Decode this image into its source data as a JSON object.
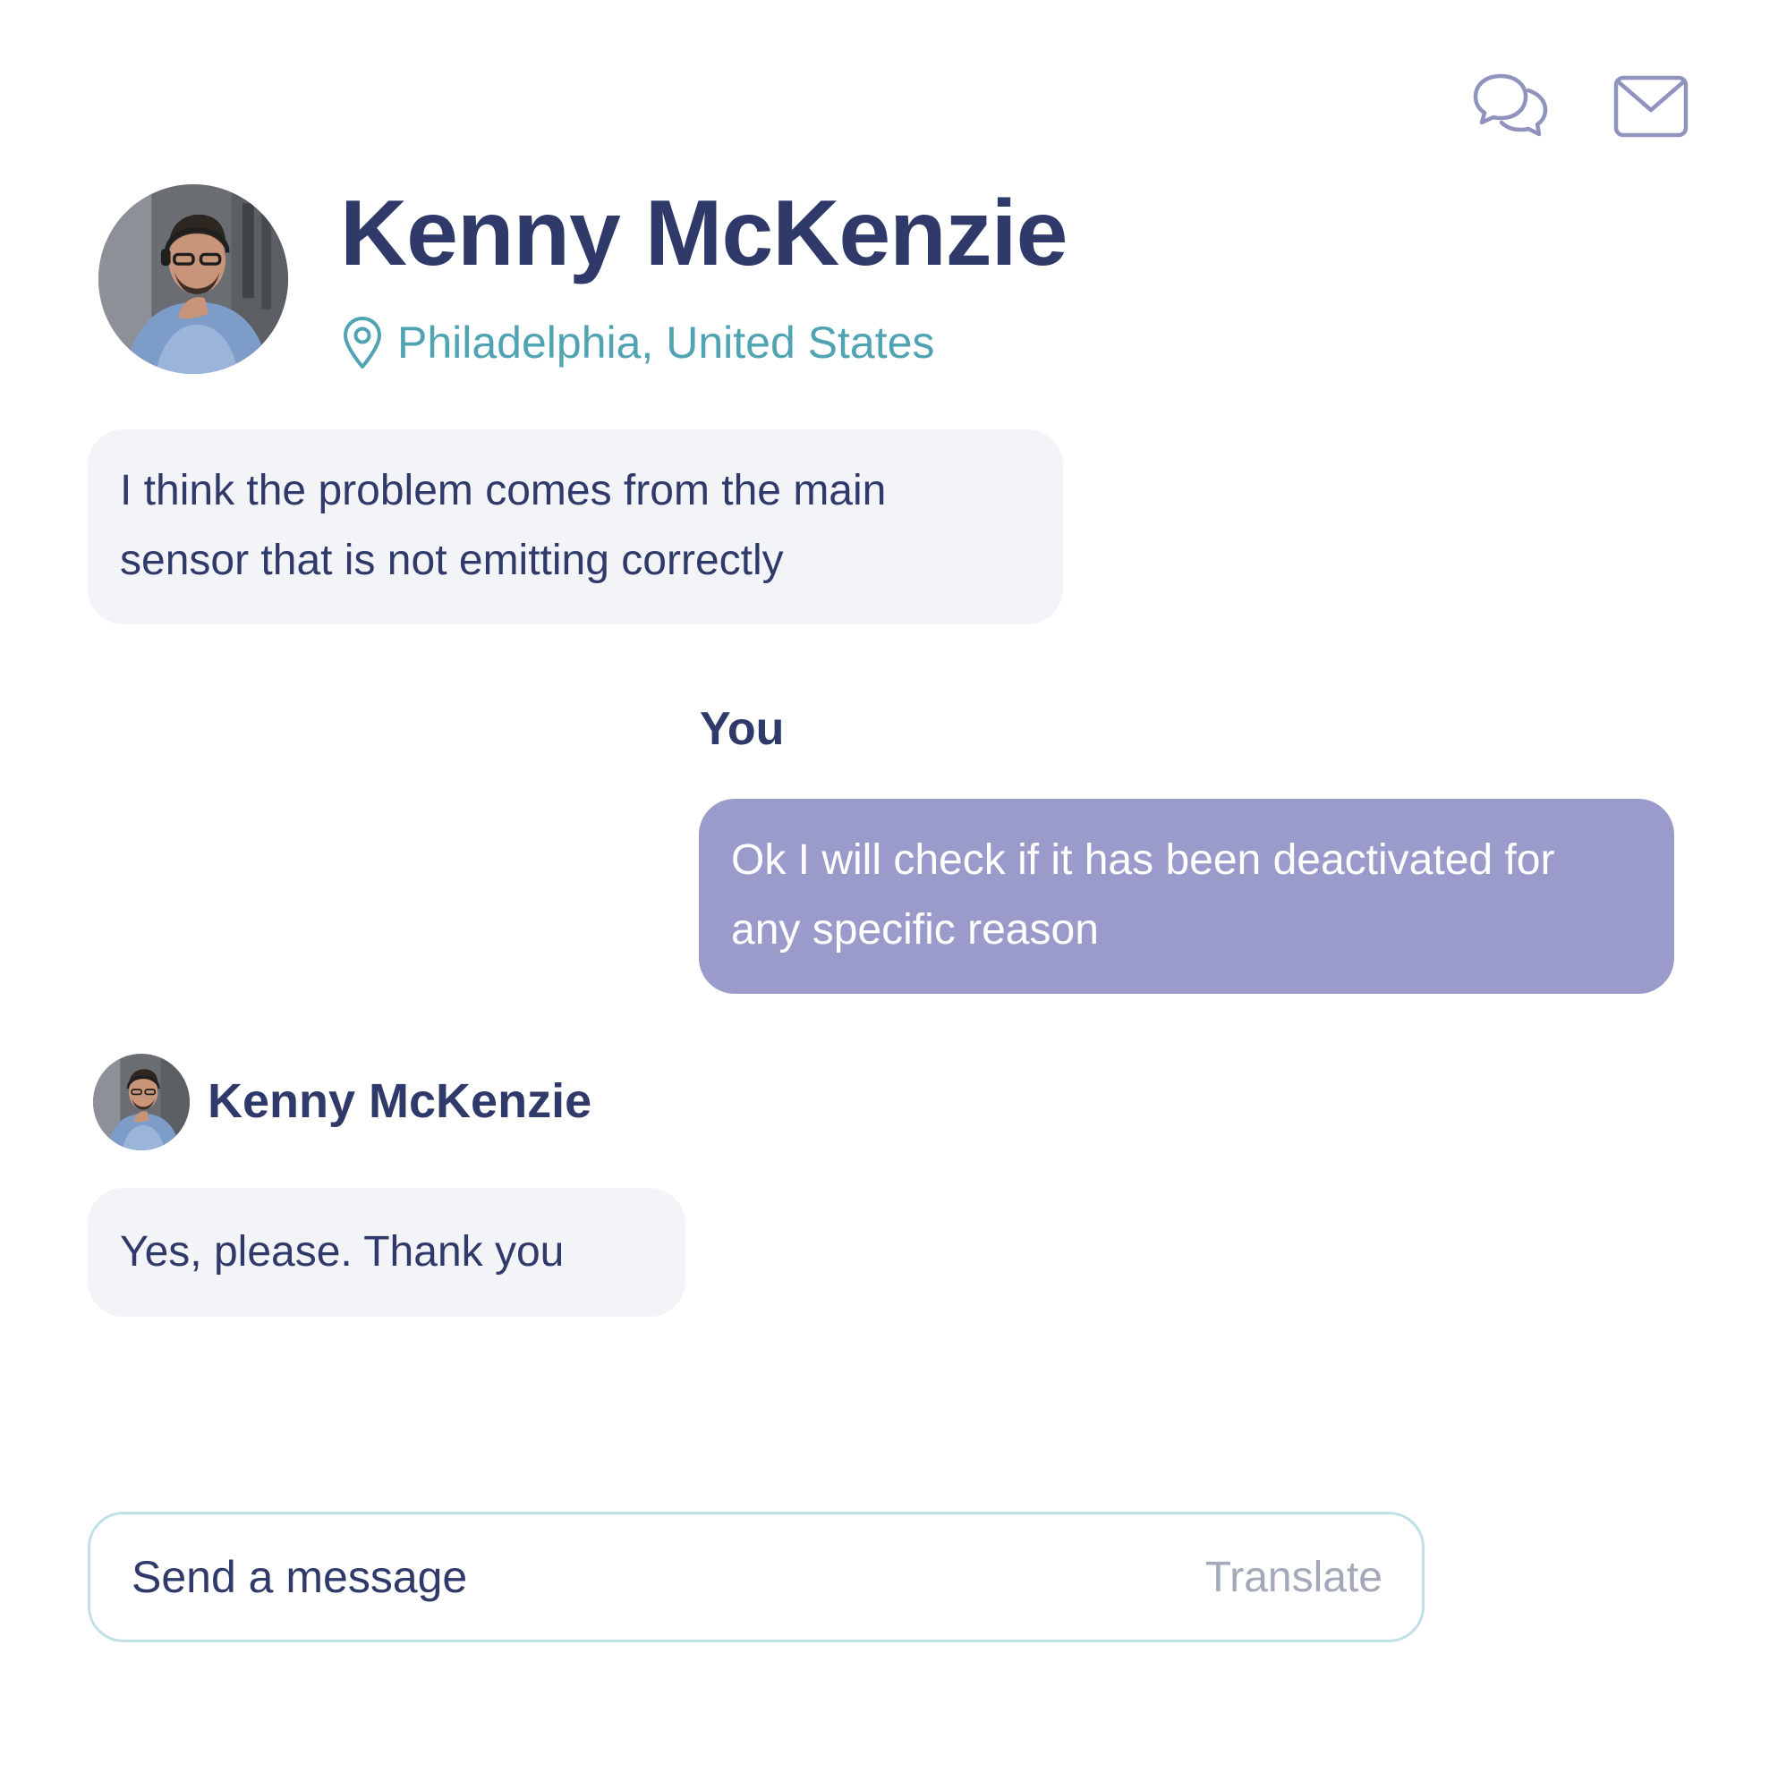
{
  "header": {
    "chat_icon": "chat-bubbles-icon",
    "mail_icon": "mail-icon",
    "contact": {
      "name": "Kenny McKenzie",
      "location_icon": "map-pin-icon",
      "location": "Philadelphia, United States",
      "avatar": "avatar-photo"
    }
  },
  "conversation": {
    "messages": [
      {
        "direction": "incoming",
        "lines": [
          "I think the problem comes from the main",
          "sensor that is not emitting correctly"
        ]
      },
      {
        "direction": "outgoing",
        "sender": "You",
        "lines": [
          "Ok I will check if it has been deactivated for",
          "any specific reason"
        ]
      },
      {
        "direction": "incoming",
        "sender": "Kenny McKenzie",
        "lines": [
          "Yes, please. Thank you"
        ]
      }
    ]
  },
  "composer": {
    "placeholder": "Send a message",
    "translate_label": "Translate"
  },
  "colors": {
    "primary_text": "#2f3a6b",
    "location_accent": "#4fa3b3",
    "incoming_bubble": "#f3f4f8",
    "outgoing_bubble": "#9b9bcb",
    "icon_stroke": "#8f93bd",
    "composer_border": "#bfe0e6"
  }
}
